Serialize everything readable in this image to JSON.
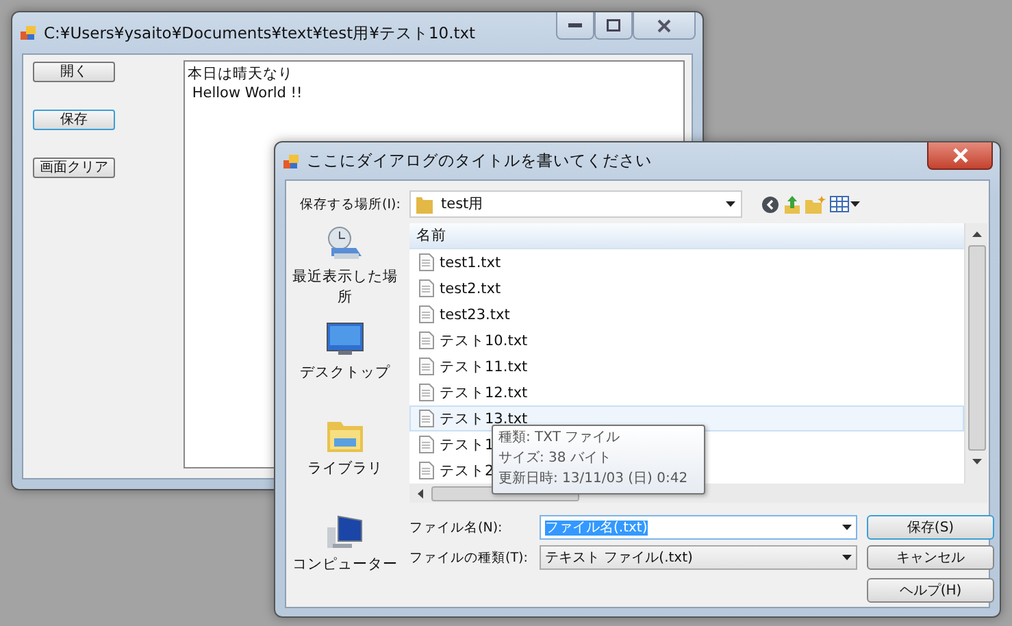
{
  "main_window": {
    "title": "C:¥Users¥ysaito¥Documents¥text¥test用¥テスト10.txt",
    "buttons": [
      {
        "label": "開く",
        "focused": false
      },
      {
        "label": "保存",
        "focused": true
      },
      {
        "label": "画面クリア",
        "focused": false
      }
    ],
    "text_lines": [
      "本日は晴天なり",
      " Hellow World !!"
    ]
  },
  "dialog": {
    "title": "ここにダイアログのタイトルを書いてください",
    "save_in": {
      "label": "保存する場所(I):",
      "value": "test用"
    },
    "places": [
      {
        "label": "最近表示した場所",
        "kind": "recent"
      },
      {
        "label": "デスクトップ",
        "kind": "desktop"
      },
      {
        "label": "ライブラリ",
        "kind": "library"
      },
      {
        "label": "コンピューター",
        "kind": "computer"
      }
    ],
    "file_list": {
      "column": "名前",
      "files": [
        {
          "name": "test1.txt",
          "selected": false
        },
        {
          "name": "test2.txt",
          "selected": false
        },
        {
          "name": "test23.txt",
          "selected": false
        },
        {
          "name": "テスト10.txt",
          "selected": false
        },
        {
          "name": "テスト11.txt",
          "selected": false
        },
        {
          "name": "テスト12.txt",
          "selected": false
        },
        {
          "name": "テスト13.txt",
          "selected": true
        },
        {
          "name": "テスト1",
          "selected": false
        },
        {
          "name": "テスト2",
          "selected": false
        }
      ]
    },
    "tooltip": [
      "種類: TXT ファイル",
      "サイズ: 38 バイト",
      "更新日時: 13/11/03 (日) 0:42"
    ],
    "file_name": {
      "label": "ファイル名(N):",
      "value": "ファイル名(.txt)"
    },
    "file_type": {
      "label": "ファイルの種類(T):",
      "value": "テキスト ファイル(.txt)"
    },
    "buttons": [
      {
        "label": "保存(S)",
        "focused": true
      },
      {
        "label": "キャンセル",
        "focused": false
      },
      {
        "label": "ヘルプ(H)",
        "focused": false
      }
    ]
  }
}
